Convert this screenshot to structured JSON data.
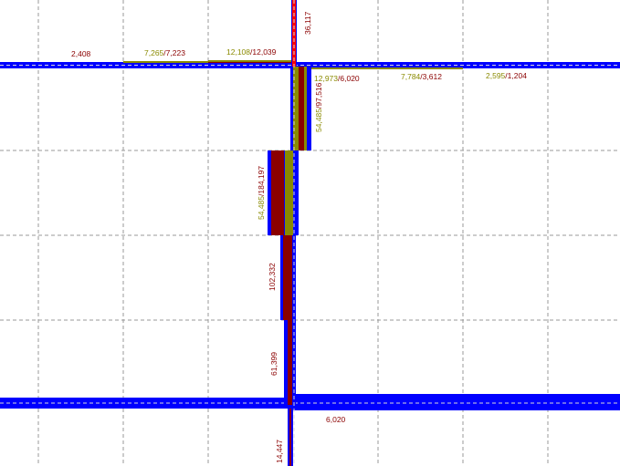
{
  "colors": {
    "background": "#ffffff",
    "grid": "#999999",
    "road": "#0000ff",
    "road_center": "#d8d8d8",
    "flow_olive": "#8a8a00",
    "flow_dark_red": "#8b0000",
    "flow_red": "#ff0000",
    "label_olive": "#8a8a00",
    "label_dark_red": "#8b0000"
  },
  "labels": {
    "top_n": "36,117",
    "w1": "2,408",
    "w2_a": "7,265",
    "w2_b": "7,223",
    "w3_a": "12,108",
    "w3_b": "12,039",
    "e1_a": "12,973",
    "e1_b": "6,020",
    "e2_a": "7,784",
    "e2_b": "3,612",
    "e3_a": "2,595",
    "e3_b": "1,204",
    "v1_a": "54,485",
    "v1_b": "97,516",
    "v2_a": "54,485",
    "v2_b": "184,197",
    "v3": "102,332",
    "v4": "61,399",
    "bottom_e": "6,020",
    "bottom_s": "14,447",
    "slash": "/"
  }
}
